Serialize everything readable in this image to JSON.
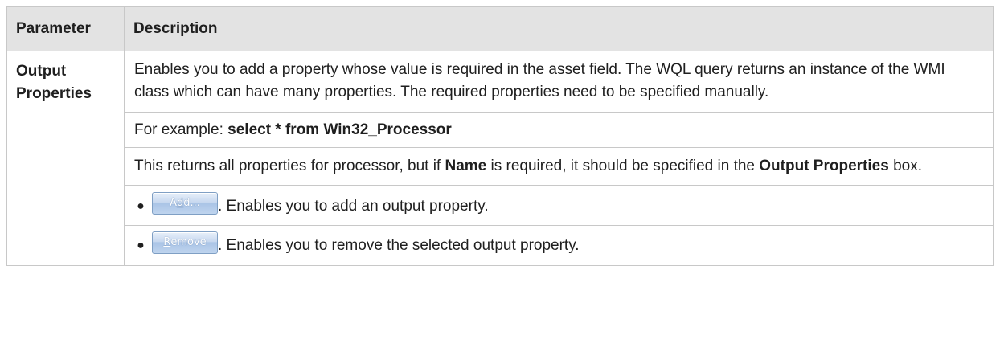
{
  "header": {
    "col_parameter": "Parameter",
    "col_description": "Description"
  },
  "row": {
    "parameter_line1": "Output",
    "parameter_line2": "Properties",
    "para1": "Enables you to add a property whose value is required in the asset field. The WQL query returns an instance of the WMI class which can have many properties. The required properties need to be specified manually.",
    "para2_prefix": "For example: ",
    "para2_bold": "select * from Win32_Processor",
    "para3_part1": "This returns all properties for processor, but if ",
    "para3_bold1": "Name",
    "para3_part2": " is required, it should be specified in the ",
    "para3_bold2": "Output Properties",
    "para3_part3": " box.",
    "bullets": [
      {
        "button_label_prefix": "A",
        "button_label_mnemonic": "d",
        "button_label_suffix": "d...",
        "text": ". Enables you to add an output property."
      },
      {
        "button_label_prefix": "",
        "button_label_mnemonic": "R",
        "button_label_suffix": "emove",
        "text": ". Enables you to remove the selected output property."
      }
    ]
  }
}
